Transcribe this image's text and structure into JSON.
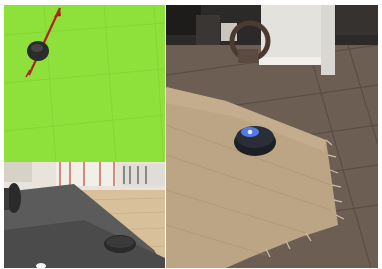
{
  "panels": {
    "simulation": {
      "label": "simulation-topdown-view"
    },
    "render": {
      "label": "rendered-scene-view"
    },
    "photo": {
      "label": "real-world-photo"
    }
  },
  "colors": {
    "sim_ground": "#8ee03a",
    "sim_grid": "#7cc830",
    "robot_dark": "#2e2e2e",
    "heading_arrow": "#b0231a",
    "floor_wood": "#7b6a58",
    "rug": "#b8a382",
    "robot_light": "#4c7cff"
  }
}
